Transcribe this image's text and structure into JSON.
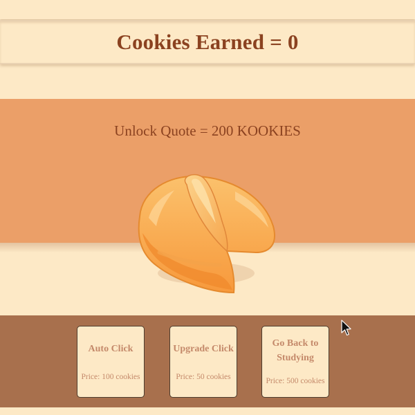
{
  "header": {
    "cookies_label": "Cookies Earned = 0"
  },
  "quote": {
    "unlock_text": "Unlock Quote = 200 KOOKIES"
  },
  "shop": {
    "items": [
      {
        "title": "Auto Click",
        "price": "Price: 100 cookies"
      },
      {
        "title": "Upgrade Click",
        "price": "Price: 50 cookies"
      },
      {
        "title": "Go Back to Studying",
        "price": "Price: 500 cookies"
      }
    ]
  },
  "colors": {
    "background": "#fde9c6",
    "quote_band": "#eb9f68",
    "shop_bar": "#a8704d",
    "title_text": "#8b4220",
    "button_text": "#c4896a"
  },
  "icons": {
    "cookie": "fortune-cookie-icon",
    "pointer": "mouse-cursor-icon"
  }
}
